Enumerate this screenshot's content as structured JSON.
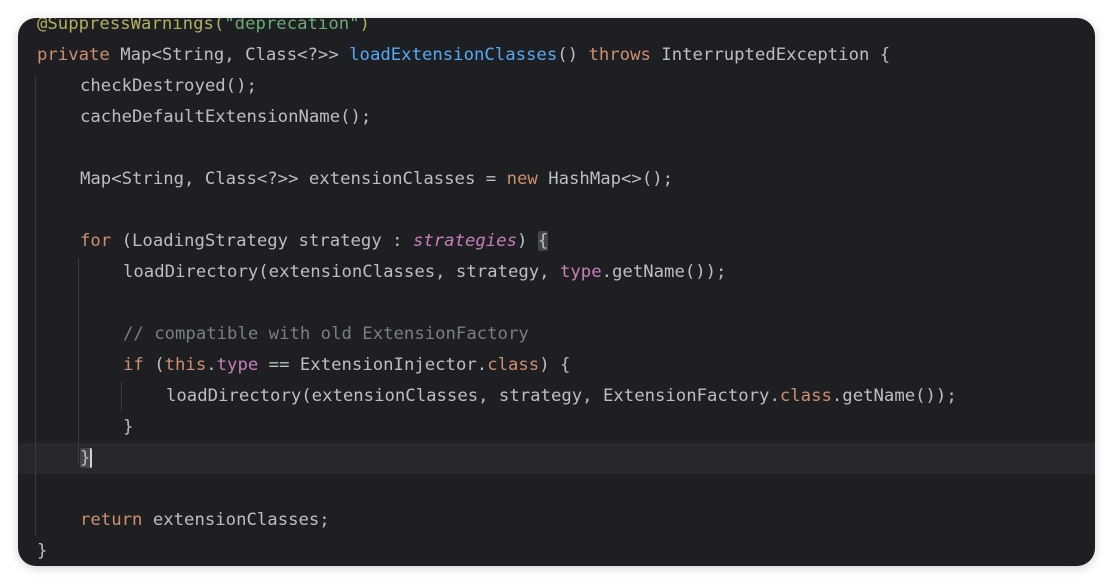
{
  "editor": {
    "line1": {
      "annotation": "@SuppressWarnings(",
      "string": "\"deprecation\"",
      "close": ")"
    },
    "line2": {
      "kw_private": "private",
      "return_type": " Map<String, Class<?>> ",
      "method": "loadExtensionClasses",
      "parens": "() ",
      "kw_throws": "throws",
      "rest": " InterruptedException {"
    },
    "line3": {
      "text": "checkDestroyed();"
    },
    "line4": {
      "text": "cacheDefaultExtensionName();"
    },
    "line6": {
      "pre": "Map<String, Class<?>> extensionClasses = ",
      "kw_new": "new",
      "post": " HashMap<>();"
    },
    "line8": {
      "kw_for": "for",
      "pre": " (LoadingStrategy strategy : ",
      "field": "strategies",
      "post": ") ",
      "brace": "{"
    },
    "line9": {
      "pre": "loadDirectory(extensionClasses, strategy, ",
      "field": "type",
      "post": ".getName());"
    },
    "line11": {
      "comment": "// compatible with old ExtensionFactory"
    },
    "line12": {
      "kw_if": "if",
      "open": " (",
      "kw_this": "this",
      "dot": ".",
      "field": "type",
      "mid": " == ExtensionInjector.",
      "kw_class": "class",
      "post": ") {"
    },
    "line13": {
      "pre": "loadDirectory(extensionClasses, strategy, ExtensionFactory.",
      "kw_class": "class",
      "post": ".getName());"
    },
    "line14": {
      "text": "}"
    },
    "line15": {
      "brace": "}"
    },
    "line17": {
      "kw_return": "return",
      "post": " extensionClasses;"
    },
    "line18": {
      "text": "}"
    }
  }
}
